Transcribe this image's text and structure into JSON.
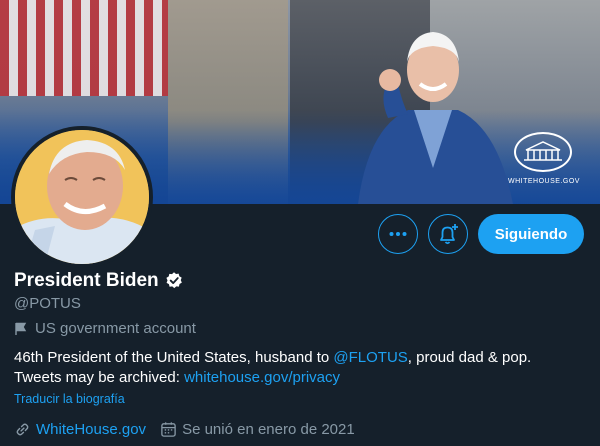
{
  "banner": {
    "logo_text": "WHITEHOUSE.GOV"
  },
  "actions": {
    "more_icon": "more-horizontal-icon",
    "bell_icon": "notification-bell-plus-icon",
    "follow_label": "Siguiendo"
  },
  "profile": {
    "name": "President Biden",
    "handle": "@POTUS",
    "account_label": "US government account",
    "bio": {
      "line1_prefix": "46th President of the United States, husband to ",
      "line1_mention": "@FLOTUS",
      "line1_suffix": ", proud dad & pop.",
      "line2_prefix": "Tweets may be archived: ",
      "line2_link": "whitehouse.gov/privacy"
    },
    "translate_label": "Traducir la biografía",
    "website": "WhiteHouse.gov",
    "joined": "Se unió en enero de 2021"
  },
  "colors": {
    "background": "#15202b",
    "accent": "#1da1f2",
    "secondary_text": "#8899a6"
  }
}
